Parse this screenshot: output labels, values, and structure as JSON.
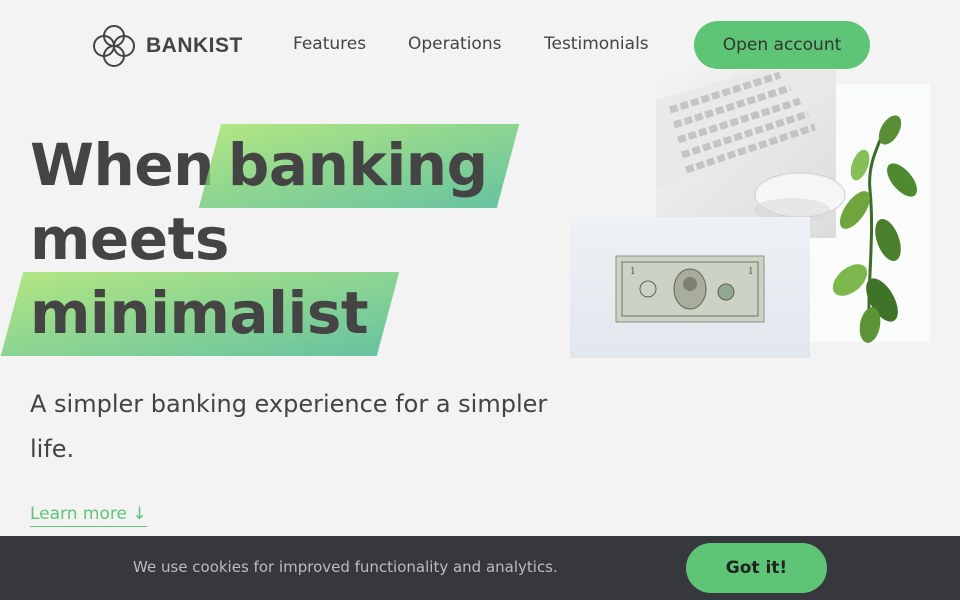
{
  "brand": {
    "name": "BANKIST",
    "logo_icon": "interlocking-circles-logo"
  },
  "nav": {
    "features": "Features",
    "operations": "Operations",
    "testimonials": "Testimonials",
    "open_account": "Open account"
  },
  "hero": {
    "title_word_1": "When",
    "title_word_2": "banking",
    "title_word_3": "meets",
    "title_word_4": "minimalist",
    "subtitle": "A simpler banking experience for a simpler life.",
    "learn_more": "Learn more",
    "learn_more_icon": "arrow-down-icon",
    "learn_more_icon_glyph": "↓"
  },
  "cookie": {
    "message": "We use cookies for improved functionality and analytics.",
    "button": "Got it!"
  },
  "colors": {
    "accent": "#5ec576",
    "background": "#f3f3f3",
    "cookie_bar": "#37383d",
    "highlight_start": "#9be15d",
    "highlight_end": "#39b385"
  }
}
